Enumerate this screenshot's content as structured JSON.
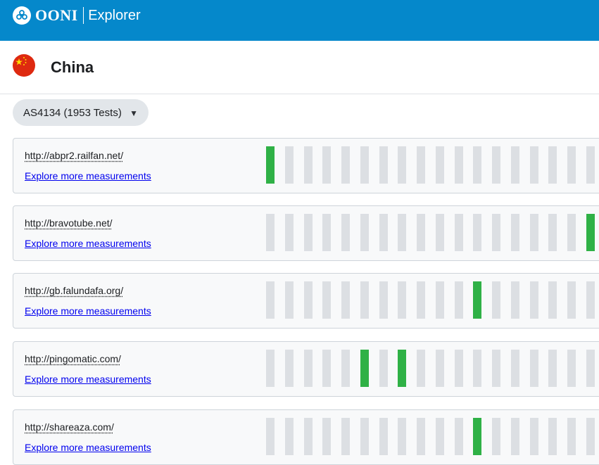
{
  "header": {
    "brand": "OONI",
    "product": "Explorer",
    "logo_icon": "ooni-logo-icon"
  },
  "country": {
    "name": "China",
    "flag_icon": "china-flag-icon"
  },
  "network_select": {
    "selected": "AS4134 (1953 Tests)",
    "arrow_icon": "triangle-down-icon"
  },
  "colors": {
    "header_bg": "#0588cb",
    "ok_bar": "#2fb146",
    "empty_bar": "#dcdfe3",
    "link": "#0000ee"
  },
  "measurements": [
    {
      "url": "http://abpr2.railfan.net/",
      "link": "Explore more measurements",
      "bars": [
        "ok",
        "none",
        "none",
        "none",
        "none",
        "none",
        "none",
        "none",
        "none",
        "none",
        "none",
        "none",
        "none",
        "none",
        "none",
        "none",
        "none",
        "none"
      ]
    },
    {
      "url": "http://bravotube.net/",
      "link": "Explore more measurements",
      "bars": [
        "none",
        "none",
        "none",
        "none",
        "none",
        "none",
        "none",
        "none",
        "none",
        "none",
        "none",
        "none",
        "none",
        "none",
        "none",
        "none",
        "none",
        "ok"
      ]
    },
    {
      "url": "http://gb.falundafa.org/",
      "link": "Explore more measurements",
      "bars": [
        "none",
        "none",
        "none",
        "none",
        "none",
        "none",
        "none",
        "none",
        "none",
        "none",
        "none",
        "ok",
        "none",
        "none",
        "none",
        "none",
        "none",
        "none"
      ]
    },
    {
      "url": "http://pingomatic.com/",
      "link": "Explore more measurements",
      "bars": [
        "none",
        "none",
        "none",
        "none",
        "none",
        "ok",
        "none",
        "ok",
        "none",
        "none",
        "none",
        "none",
        "none",
        "none",
        "none",
        "none",
        "none",
        "none"
      ]
    },
    {
      "url": "http://shareaza.com/",
      "link": "Explore more measurements",
      "bars": [
        "none",
        "none",
        "none",
        "none",
        "none",
        "none",
        "none",
        "none",
        "none",
        "none",
        "none",
        "ok",
        "none",
        "none",
        "none",
        "none",
        "none",
        "none"
      ]
    }
  ]
}
